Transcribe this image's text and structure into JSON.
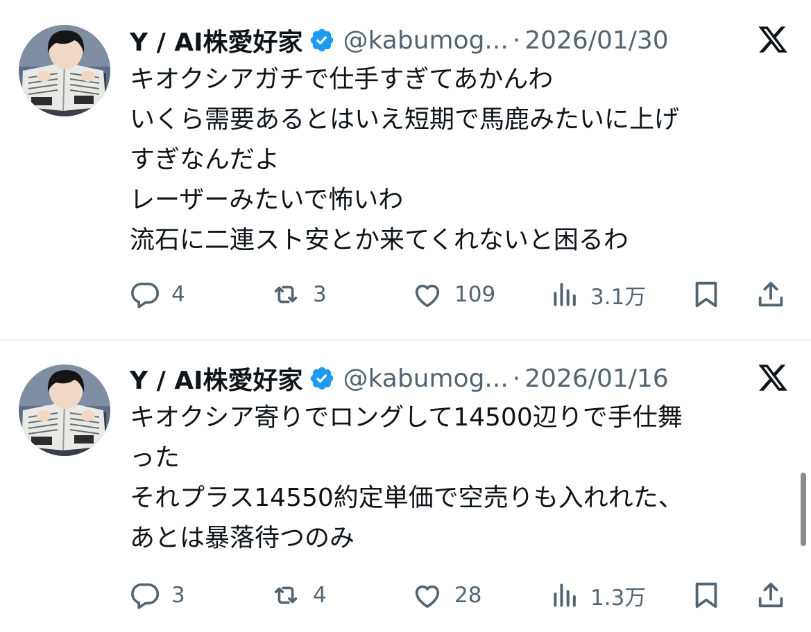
{
  "tweets": [
    {
      "display_name": "Y / AI株愛好家",
      "handle": "@kabumog...",
      "separator": "·",
      "date": "2026/01/30",
      "lines": [
        "キオクシアガチで仕手すぎてあかんわ",
        "いくら需要あるとはいえ短期で馬鹿みたいに上げ",
        "すぎなんだよ",
        "レーザーみたいで怖いわ",
        "流石に二連スト安とか来てくれないと困るわ"
      ],
      "replies": "4",
      "reposts": "3",
      "likes": "109",
      "views": "3.1万"
    },
    {
      "display_name": "Y / AI株愛好家",
      "handle": "@kabumog...",
      "separator": "·",
      "date": "2026/01/16",
      "lines": [
        "キオクシア寄りでロングして14500辺りで手仕舞",
        "った",
        "それプラス14550約定単価で空売りも入れれた、",
        "あとは暴落待つのみ"
      ],
      "replies": "3",
      "reposts": "4",
      "likes": "28",
      "views": "1.3万"
    }
  ],
  "icons": {
    "verified": "verified-badge-icon",
    "brand": "x-logo-icon",
    "reply": "reply-icon",
    "repost": "repost-icon",
    "like": "heart-icon",
    "views": "views-icon",
    "bookmark": "bookmark-icon",
    "share": "share-icon"
  },
  "colors": {
    "verified": "#1d9bf0",
    "text": "#0f1419",
    "secondary": "#536471",
    "divider": "#eff3f4"
  }
}
